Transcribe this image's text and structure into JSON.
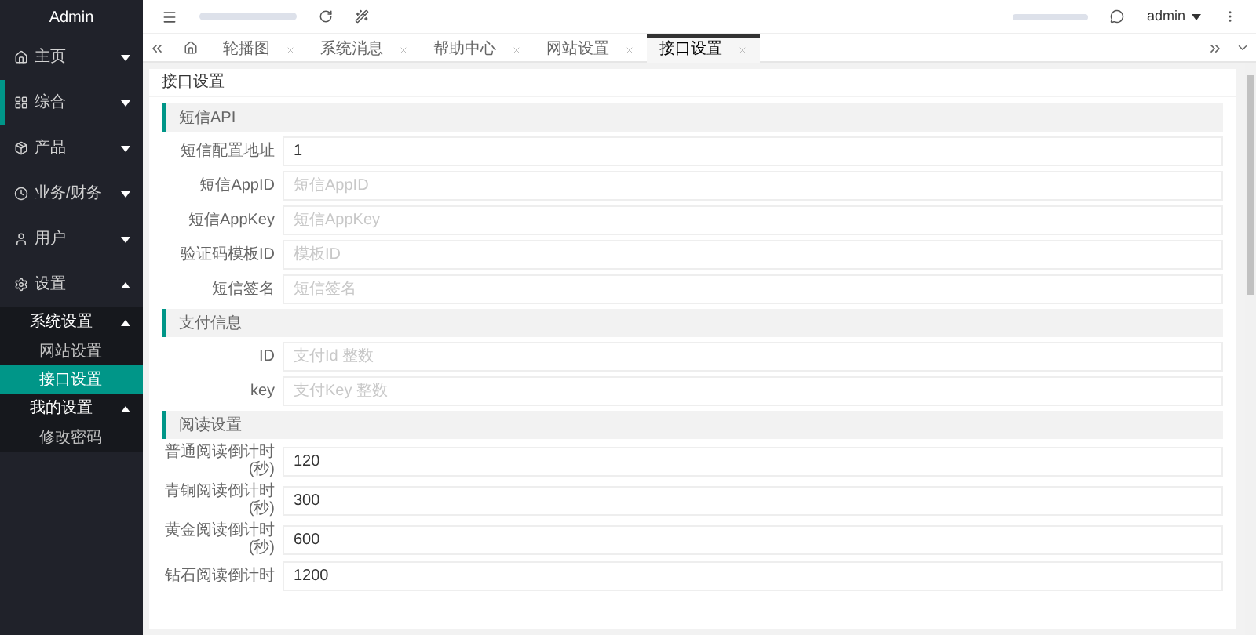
{
  "sidebar": {
    "title": "Admin",
    "items": [
      {
        "label": "主页",
        "expanded": false,
        "selected": false
      },
      {
        "label": "综合",
        "expanded": false,
        "selected": true
      },
      {
        "label": "产品",
        "expanded": false,
        "selected": false
      },
      {
        "label": "业务/财务",
        "expanded": false,
        "selected": false
      },
      {
        "label": "用户",
        "expanded": false,
        "selected": false
      },
      {
        "label": "设置",
        "expanded": true,
        "selected": false,
        "children": [
          {
            "label": "系统设置",
            "expanded": true,
            "children": [
              {
                "label": "网站设置",
                "selected": false
              },
              {
                "label": "接口设置",
                "selected": true
              }
            ]
          },
          {
            "label": "我的设置",
            "expanded": true,
            "children": [
              {
                "label": "修改密码",
                "selected": false
              }
            ]
          }
        ]
      }
    ]
  },
  "header": {
    "user": "admin"
  },
  "tabs": [
    {
      "label": "轮播图",
      "selected": false
    },
    {
      "label": "系统消息",
      "selected": false
    },
    {
      "label": "帮助中心",
      "selected": false
    },
    {
      "label": "网站设置",
      "selected": false
    },
    {
      "label": "接口设置",
      "selected": true
    }
  ],
  "panel": {
    "title": "接口设置",
    "sections": [
      {
        "title": "短信API",
        "fields": [
          {
            "label": "短信配置地址",
            "value": "1"
          },
          {
            "label": "短信AppID",
            "placeholder": "短信AppID"
          },
          {
            "label": "短信AppKey",
            "placeholder": "短信AppKey"
          },
          {
            "label": "验证码模板ID",
            "placeholder": "模板ID"
          },
          {
            "label": "短信签名",
            "placeholder": "短信签名"
          }
        ]
      },
      {
        "title": "支付信息",
        "fields": [
          {
            "label": "ID",
            "placeholder": "支付Id 整数"
          },
          {
            "label": "key",
            "placeholder": "支付Key 整数"
          }
        ]
      },
      {
        "title": "阅读设置",
        "fields": [
          {
            "label": "普通阅读倒计时(秒)",
            "value": "120"
          },
          {
            "label": "青铜阅读倒计时(秒)",
            "value": "300"
          },
          {
            "label": "黄金阅读倒计时(秒)",
            "value": "600"
          },
          {
            "label": "钻石阅读倒计时",
            "value": "1200"
          }
        ]
      }
    ]
  }
}
